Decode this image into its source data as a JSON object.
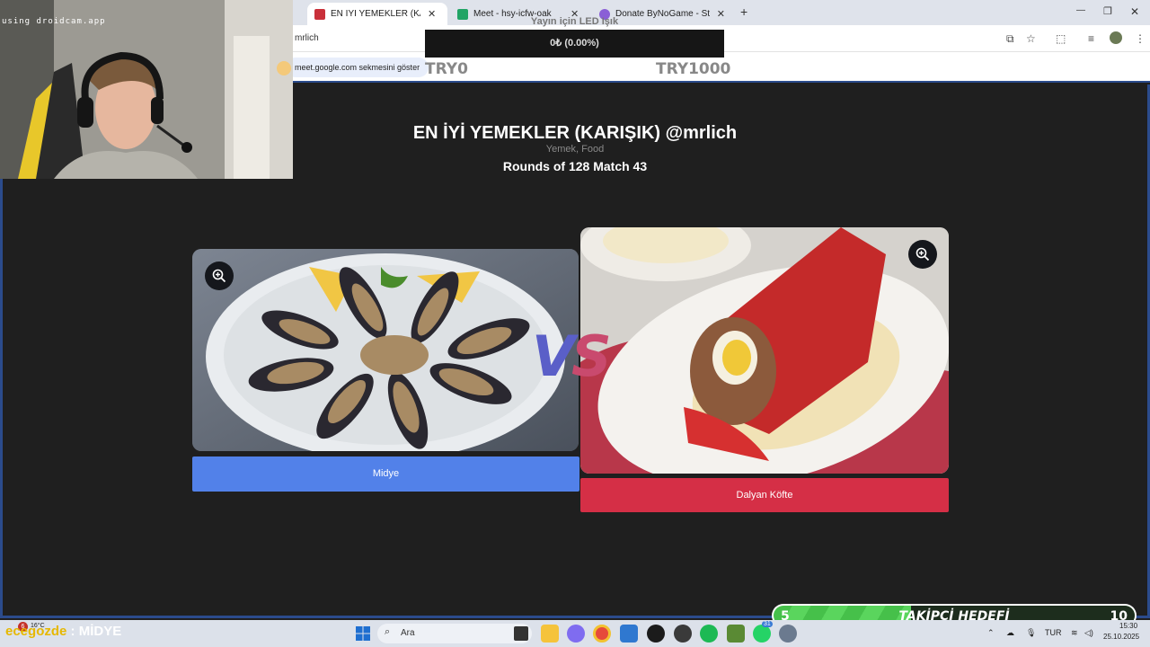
{
  "browser": {
    "tabs": [
      {
        "label": "EN İYİ YEMEKLER (KARIŞIK) @mrlich",
        "active": true
      },
      {
        "label": "Meet - hsy-icfw-oak",
        "active": false
      },
      {
        "label": "Donate ByNoGame - Streamer",
        "active": false
      }
    ],
    "tab_close": "✕",
    "new_tab": "+",
    "url": "mrlich",
    "meet_prompt": "meet.google.com sekmesini göster",
    "window_controls": {
      "minimize": "—",
      "restore": "❐",
      "close": "✕"
    }
  },
  "donation": {
    "title": "Yayın için LED Işık",
    "amount": "0₺ (0.00%)",
    "min": "TRY0",
    "max": "TRY1000",
    "progress_fraction": 0
  },
  "webcam": {
    "label": "using droidcam.app"
  },
  "page": {
    "title": "EN İYİ YEMEKLER (KARIŞIK) @mrlich",
    "subtitle": "Yemek, Food",
    "round_info": "Rounds of 128 Match 43",
    "vs_v": "V",
    "vs_s": "S",
    "left_choice": {
      "label": "Midye",
      "color": "#5281e9"
    },
    "right_choice": {
      "label": "Dalyan Köfte",
      "color": "#d52f46"
    }
  },
  "stream_overlay": {
    "brand": "ecegozde",
    "separator": " : ",
    "current_item": "MİDYE",
    "weather": "16°C",
    "notifications": "6"
  },
  "follower_goal": {
    "current": "5",
    "label": "TAKİPÇİ HEDEFİ",
    "target": "10"
  },
  "taskbar": {
    "search_placeholder": "Ara",
    "language": "TUR",
    "time": "15:30",
    "date": "25.10.2025",
    "whatsapp_badge": "31"
  }
}
